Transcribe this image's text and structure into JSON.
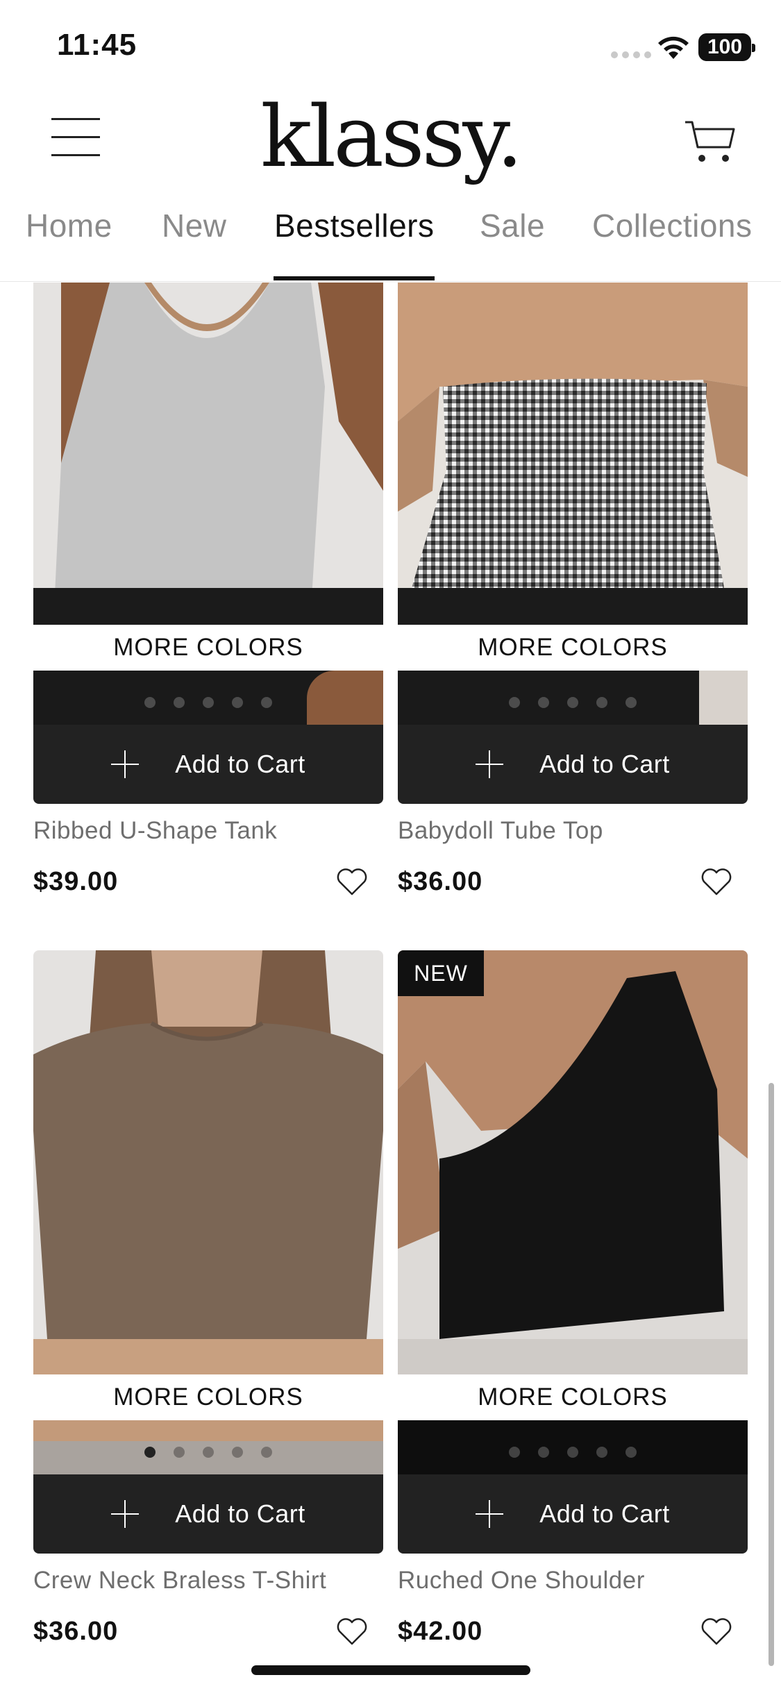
{
  "status_bar": {
    "time": "11:45",
    "battery": "100"
  },
  "header": {
    "logo": "klassy."
  },
  "tabs": [
    {
      "label": "Home",
      "active": false
    },
    {
      "label": "New",
      "active": false
    },
    {
      "label": "Bestsellers",
      "active": true
    },
    {
      "label": "Sale",
      "active": false
    },
    {
      "label": "Collections",
      "active": false
    }
  ],
  "products": [
    {
      "name": "Ribbed U-Shape Tank",
      "price": "$39.00",
      "more_colors": "MORE COLORS",
      "add_to_cart": "Add to Cart",
      "badge": null
    },
    {
      "name": "Babydoll Tube Top",
      "price": "$36.00",
      "more_colors": "MORE COLORS",
      "add_to_cart": "Add to Cart",
      "badge": null
    },
    {
      "name": "Crew Neck Braless T-Shirt",
      "price": "$36.00",
      "more_colors": "MORE COLORS",
      "add_to_cart": "Add to Cart",
      "badge": null
    },
    {
      "name": "Ruched One Shoulder",
      "price": "$42.00",
      "more_colors": "MORE COLORS",
      "add_to_cart": "Add to Cart",
      "badge": "NEW"
    }
  ],
  "colors": {
    "button_bg": "#222222",
    "text": "#111111",
    "muted": "#8a8a8a"
  },
  "icons": {
    "menu": "hamburger-menu-icon",
    "cart": "shopping-cart-icon",
    "wishlist": "heart-outline-icon",
    "add": "plus-icon"
  }
}
